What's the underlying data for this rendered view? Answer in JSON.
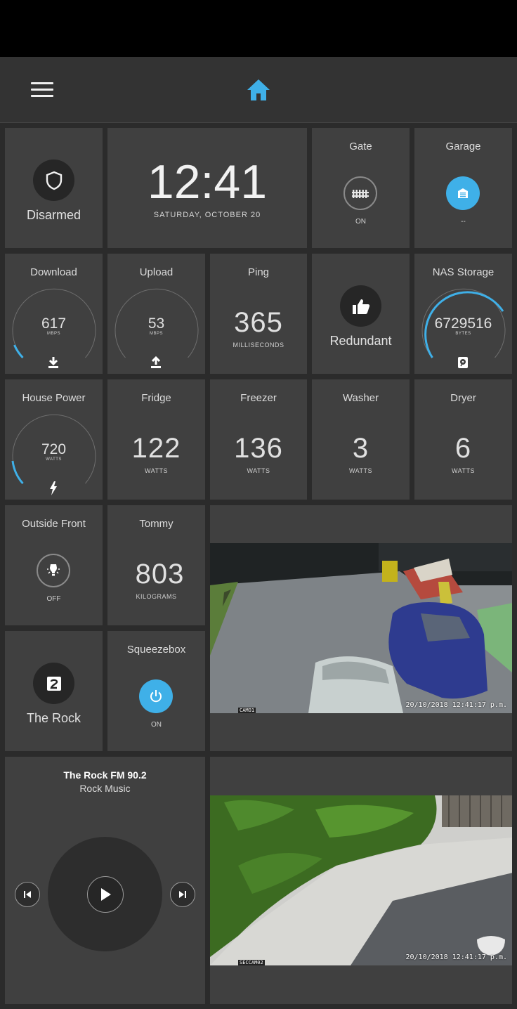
{
  "header": {
    "menu_icon": "menu-icon",
    "home_icon": "home-icon",
    "accent": "#3fb0e8"
  },
  "security": {
    "label": "Disarmed",
    "icon": "shield-icon"
  },
  "clock": {
    "time": "12:41",
    "date": "SATURDAY, OCTOBER 20"
  },
  "gate": {
    "title": "Gate",
    "state": "ON",
    "icon": "gate-icon"
  },
  "garage": {
    "title": "Garage",
    "state": "--",
    "icon": "garage-icon"
  },
  "download": {
    "title": "Download",
    "value": "617",
    "unit": "MBPS",
    "level": 0.05,
    "icon": "download-icon"
  },
  "upload": {
    "title": "Upload",
    "value": "53",
    "unit": "MBPS",
    "level": 0.01,
    "icon": "upload-icon"
  },
  "ping": {
    "title": "Ping",
    "value": "365",
    "unit": "MILLISECONDS"
  },
  "redundant": {
    "label": "Redundant",
    "icon": "thumbs-up-icon"
  },
  "nas": {
    "title": "NAS Storage",
    "value": "6729516",
    "unit": "BYTES",
    "level": 0.67,
    "icon": "hard-drive-icon"
  },
  "house_power": {
    "title": "House Power",
    "value": "720",
    "unit": "WATTS",
    "level": 0.09,
    "icon": "lightning-icon"
  },
  "fridge": {
    "title": "Fridge",
    "value": "122",
    "unit": "WATTS"
  },
  "freezer": {
    "title": "Freezer",
    "value": "136",
    "unit": "WATTS"
  },
  "washer": {
    "title": "Washer",
    "value": "3",
    "unit": "WATTS"
  },
  "dryer": {
    "title": "Dryer",
    "value": "6",
    "unit": "WATTS"
  },
  "outside_front": {
    "title": "Outside Front",
    "state": "OFF",
    "icon": "light-bulb-icon"
  },
  "tommy": {
    "title": "Tommy",
    "value": "803",
    "unit": "KILOGRAMS"
  },
  "the_rock": {
    "label": "The Rock",
    "icon": "number-2-icon"
  },
  "squeezebox": {
    "title": "Squeezebox",
    "state": "ON",
    "icon": "power-icon"
  },
  "player": {
    "station": "The Rock FM 90.2",
    "genre": "Rock Music",
    "prev_icon": "skip-previous-icon",
    "play_icon": "play-icon",
    "next_icon": "skip-next-icon"
  },
  "camera1": {
    "name": "CAMO1",
    "timestamp": "20/10/2018 12:41:17 p.m."
  },
  "camera2": {
    "name": "SECCAM02",
    "timestamp": "20/10/2018 12:41:17 p.m."
  }
}
